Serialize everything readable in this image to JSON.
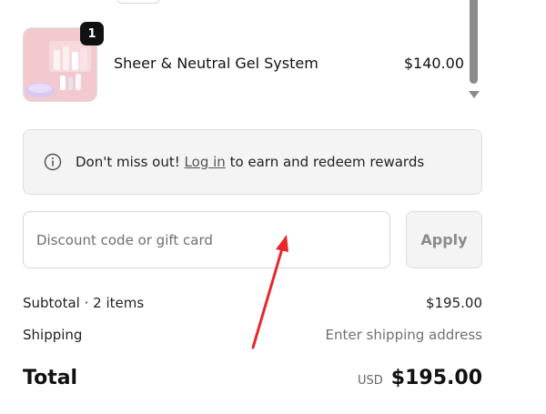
{
  "cart_item": {
    "quantity": "1",
    "name": "Sheer & Neutral Gel System",
    "price": "$140.00",
    "image_icon": "gel-kit-product-image"
  },
  "rewards_notice": {
    "icon": "info-icon",
    "prefix": "Don't miss out!",
    "link_label": "Log in",
    "suffix": "to earn and redeem rewards"
  },
  "discount": {
    "placeholder": "Discount code or gift card",
    "apply_label": "Apply"
  },
  "summary": {
    "subtotal_label": "Subtotal · 2 items",
    "subtotal_value": "$195.00",
    "shipping_label": "Shipping",
    "shipping_value": "Enter shipping address",
    "total_label": "Total",
    "currency": "USD",
    "total_value": "$195.00"
  },
  "colors": {
    "annotation_arrow": "#e8262b",
    "badge": "#111111",
    "panel_bg": "#f4f4f4"
  }
}
